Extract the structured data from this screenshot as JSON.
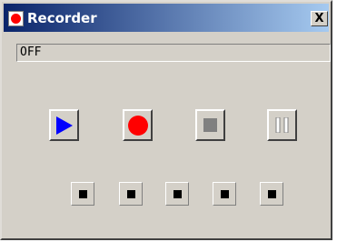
{
  "window": {
    "title": "Recorder",
    "close_glyph": "X"
  },
  "status": {
    "text": "OFF"
  },
  "controls": [
    {
      "icon": "play-icon",
      "color": "#0000ff"
    },
    {
      "icon": "record-icon",
      "color": "#ff0000"
    },
    {
      "icon": "stop-icon",
      "color": "#808080"
    },
    {
      "icon": "pause-icon",
      "color": "#808080"
    }
  ],
  "indicators": [
    {
      "icon": "indicator-square"
    },
    {
      "icon": "indicator-square"
    },
    {
      "icon": "indicator-square"
    },
    {
      "icon": "indicator-square"
    },
    {
      "icon": "indicator-square"
    }
  ]
}
